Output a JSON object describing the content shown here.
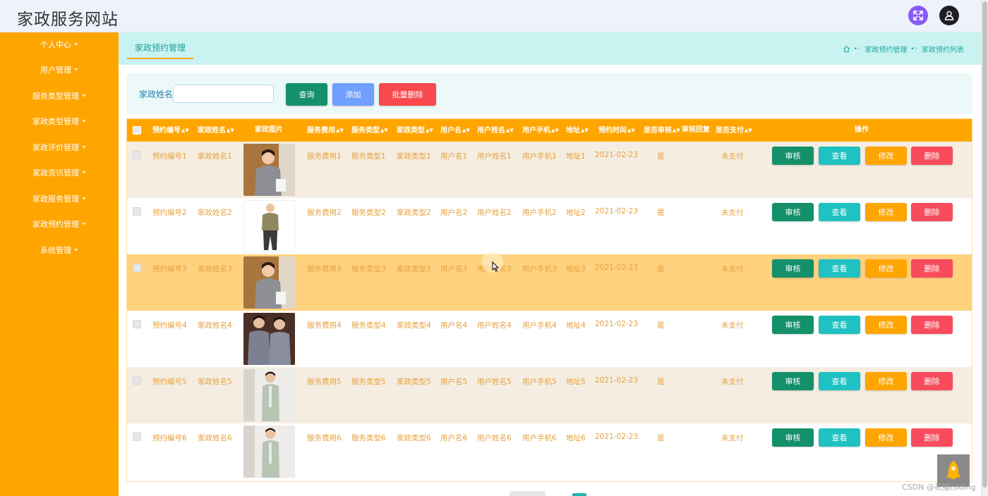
{
  "header": {
    "site_title": "家政服务网站",
    "fullscreen_color": "#8a5cf6",
    "user_color": "#1e1e24"
  },
  "sidebar": {
    "bg_color": "#ffa500",
    "items": [
      {
        "label": "个人中心"
      },
      {
        "label": "用户管理"
      },
      {
        "label": "服务类型管理"
      },
      {
        "label": "家政类型管理"
      },
      {
        "label": "家政评价管理"
      },
      {
        "label": "家政资讯管理"
      },
      {
        "label": "家政服务管理"
      },
      {
        "label": "家政预约管理"
      },
      {
        "label": "系统管理"
      }
    ]
  },
  "tabs": {
    "active_label": "家政预约管理"
  },
  "breadcrumb": {
    "items": [
      "家政预约管理",
      "家政预约列表"
    ]
  },
  "search": {
    "label": "家政姓名",
    "value": "",
    "placeholder": "",
    "query_label": "查询",
    "add_label": "添加",
    "batch_delete_label": "批量删除"
  },
  "table": {
    "headers": {
      "id": "预约编号",
      "name": "家政姓名",
      "image": "家政图片",
      "fee": "服务费用",
      "service_type": "服务类型",
      "housekeeping_type": "家政类型",
      "username": "用户名",
      "realname": "用户姓名",
      "phone": "用户手机",
      "address": "地址",
      "time": "预约时间",
      "audited": "是否审核",
      "reply": "审核回复",
      "paid": "是否支付",
      "ops": "操作"
    },
    "actions": {
      "audit": "审核",
      "view": "查看",
      "edit": "修改",
      "delete": "删除"
    },
    "rows": [
      {
        "id": "预约编号1",
        "name": "家政姓名1",
        "fee": "服务费用1",
        "service_type": "服务类型1",
        "housekeeping_type": "家政类型1",
        "username": "用户名1",
        "realname": "用户姓名1",
        "phone": "用户手机1",
        "address": "地址1",
        "time": "2021-02-23",
        "audited": "是",
        "reply": "",
        "paid": "未支付",
        "image_icon": "maid-photo-icon"
      },
      {
        "id": "预约编号2",
        "name": "家政姓名2",
        "fee": "服务费用2",
        "service_type": "服务类型2",
        "housekeeping_type": "家政类型2",
        "username": "用户名2",
        "realname": "用户姓名2",
        "phone": "用户手机2",
        "address": "地址2",
        "time": "2021-02-23",
        "audited": "是",
        "reply": "",
        "paid": "未支付",
        "image_icon": "worker-photo-icon"
      },
      {
        "id": "预约编号3",
        "name": "家政姓名3",
        "fee": "服务费用3",
        "service_type": "服务类型3",
        "housekeeping_type": "家政类型3",
        "username": "用户名3",
        "realname": "用户姓名3",
        "phone": "用户手机3",
        "address": "地址3",
        "time": "2021-02-23",
        "audited": "是",
        "reply": "",
        "paid": "未支付",
        "image_icon": "maid-photo-icon"
      },
      {
        "id": "预约编号4",
        "name": "家政姓名4",
        "fee": "服务费用4",
        "service_type": "服务类型4",
        "housekeeping_type": "家政类型4",
        "username": "用户名4",
        "realname": "用户姓名4",
        "phone": "用户手机4",
        "address": "地址4",
        "time": "2021-02-23",
        "audited": "是",
        "reply": "",
        "paid": "未支付",
        "image_icon": "couple-photo-icon"
      },
      {
        "id": "预约编号5",
        "name": "家政姓名5",
        "fee": "服务费用5",
        "service_type": "服务类型5",
        "housekeeping_type": "家政类型5",
        "username": "用户名5",
        "realname": "用户姓名5",
        "phone": "用户手机5",
        "address": "地址5",
        "time": "2021-02-23",
        "audited": "是",
        "reply": "",
        "paid": "未支付",
        "image_icon": "uniform-photo-icon"
      },
      {
        "id": "预约编号6",
        "name": "家政姓名6",
        "fee": "服务费用6",
        "service_type": "服务类型6",
        "housekeeping_type": "家政类型6",
        "username": "用户名6",
        "realname": "用户姓名6",
        "phone": "用户手机6",
        "address": "地址6",
        "time": "2021-02-23",
        "audited": "是",
        "reply": "",
        "paid": "未支付",
        "image_icon": "uniform-photo-icon"
      }
    ]
  },
  "watermark": "CSDN @花猫coding",
  "colors": {
    "accent": "#ffa500",
    "teal": "#1fc1c2",
    "green": "#14906a",
    "red": "#f84c5c",
    "row_hover": "#ffd280",
    "row_odd": "#f5ede1"
  }
}
